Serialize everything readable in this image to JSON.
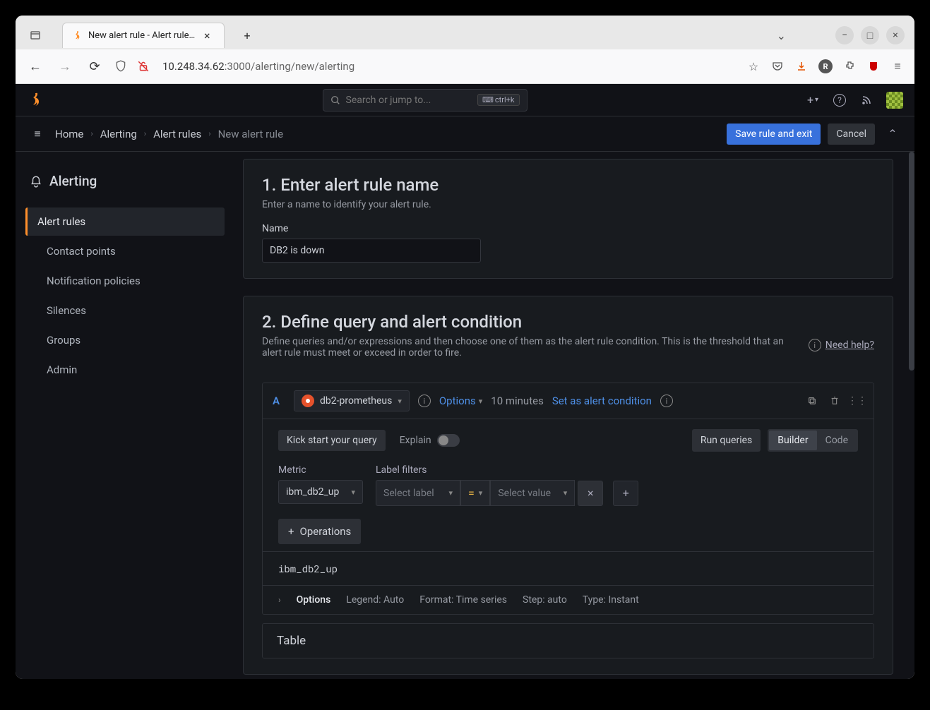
{
  "browser": {
    "tab_title": "New alert rule - Alert rule…",
    "url_host": "10.248.34.62",
    "url_port_path": ":3000/alerting/new/alerting"
  },
  "header": {
    "search_placeholder": "Search or jump to...",
    "kbd_shortcut": "ctrl+k"
  },
  "breadcrumb": {
    "items": [
      "Home",
      "Alerting",
      "Alert rules",
      "New alert rule"
    ],
    "save_btn": "Save rule and exit",
    "cancel_btn": "Cancel"
  },
  "sidebar": {
    "title": "Alerting",
    "items": [
      {
        "label": "Alert rules",
        "active": true
      },
      {
        "label": "Contact points"
      },
      {
        "label": "Notification policies"
      },
      {
        "label": "Silences"
      },
      {
        "label": "Groups"
      },
      {
        "label": "Admin"
      }
    ]
  },
  "panel1": {
    "title": "1. Enter alert rule name",
    "desc": "Enter a name to identify your alert rule.",
    "name_label": "Name",
    "name_value": "DB2 is down"
  },
  "panel2": {
    "title": "2. Define query and alert condition",
    "desc": "Define queries and/or expressions and then choose one of them as the alert rule condition. This is the threshold that an alert rule must meet or exceed in order to fire.",
    "help_label": "Need help?",
    "query": {
      "ref_id": "A",
      "datasource": "db2-prometheus",
      "options_label": "Options",
      "time_range": "10 minutes",
      "set_condition": "Set as alert condition",
      "kickstart": "Kick start your query",
      "explain": "Explain",
      "run_queries": "Run queries",
      "mode_builder": "Builder",
      "mode_code": "Code",
      "metric_label": "Metric",
      "metric_value": "ibm_db2_up",
      "filter_label": "Label filters",
      "filter_select_label": "Select label",
      "filter_eq": "=",
      "filter_select_value": "Select value",
      "operations_btn": "Operations",
      "raw_expr": "ibm_db2_up",
      "footer_options": "Options",
      "footer_legend": "Legend: Auto",
      "footer_format": "Format: Time series",
      "footer_step": "Step: auto",
      "footer_type": "Type: Instant"
    },
    "table_label": "Table"
  }
}
